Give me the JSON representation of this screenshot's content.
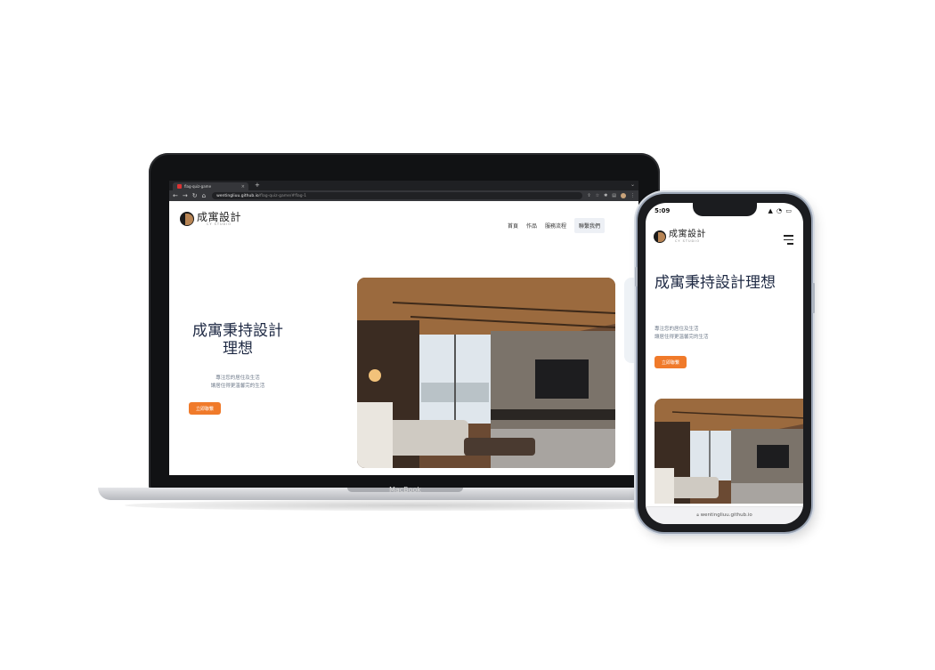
{
  "laptop": {
    "browser": {
      "tab_title": "flag-quiz-game",
      "url_host": "wentingliuu.github.io",
      "url_path": "/flag-quiz-game/#flag-1"
    },
    "device_label": "MacBook"
  },
  "site": {
    "brand": "成寓設計",
    "brand_sub": "CY STUDIO",
    "nav": [
      "首頁",
      "作品",
      "服務流程",
      "聯繫我們"
    ],
    "hero_title": "成寓秉持設計理想",
    "hero_desc_lines": [
      "專注您的居住及生活",
      "讓居住得更溫馨完的生活"
    ],
    "cta_label": "立即聯繫"
  },
  "phone": {
    "status_time": "5:09",
    "status_icons": "▲ ◔ ▭",
    "url_text": "wentingliuu.github.io"
  },
  "colors": {
    "accent": "#f07a2a",
    "title": "#1f2a44",
    "brand_mark": "#b78454"
  }
}
